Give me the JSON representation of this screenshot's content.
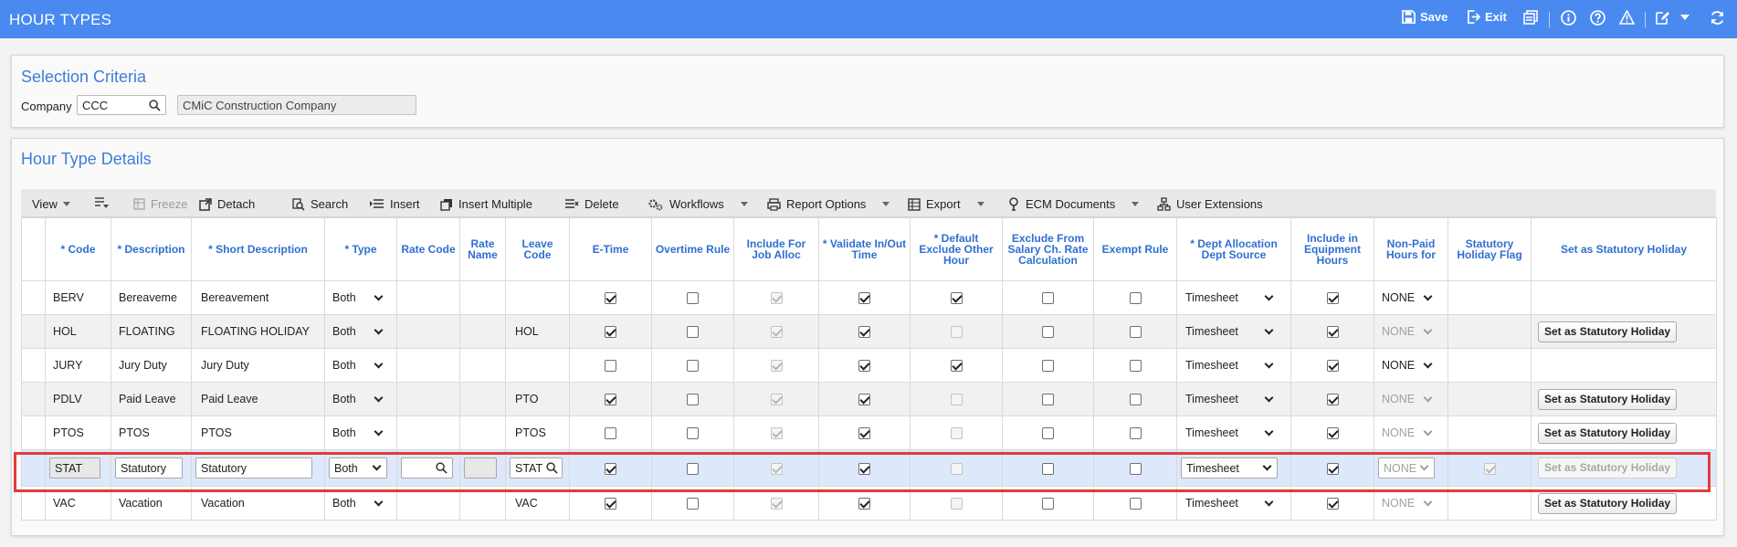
{
  "header": {
    "title": "HOUR TYPES",
    "save_label": "Save",
    "exit_label": "Exit"
  },
  "selection": {
    "title": "Selection Criteria",
    "company_label": "Company",
    "company_code": "CCC",
    "company_name": "CMiC Construction Company"
  },
  "details": {
    "title": "Hour Type Details",
    "toolbar": {
      "view": "View",
      "freeze": "Freeze",
      "detach": "Detach",
      "search": "Search",
      "insert": "Insert",
      "insert_multiple": "Insert Multiple",
      "delete": "Delete",
      "workflows": "Workflows",
      "report_options": "Report Options",
      "export": "Export",
      "ecm_documents": "ECM Documents",
      "user_extensions": "User Extensions"
    },
    "columns": {
      "code": "* Code",
      "description": "* Description",
      "short_description": "* Short Description",
      "type": "* Type",
      "rate_code": "Rate Code",
      "rate_name": "Rate Name",
      "leave_code": "Leave Code",
      "etime": "E-Time",
      "overtime_rule": "Overtime Rule",
      "include_job_alloc": "Include For Job Alloc",
      "validate_inout": "* Validate In/Out Time",
      "default_exclude": "* Default Exclude Other Hour",
      "exclude_salary": "Exclude From Salary Ch. Rate Calculation",
      "exempt_rule": "Exempt Rule",
      "dept_alloc": "* Dept Allocation Dept Source",
      "include_equip": "Include in Equipment Hours",
      "non_paid": "Non-Paid Hours for",
      "stat_flag": "Statutory Holiday Flag",
      "set_stat": "Set as Statutory Holiday"
    },
    "rows": [
      {
        "code": "BERV",
        "description": "Bereaveme",
        "short": "Bereavement",
        "type": "Both",
        "rate_code": "",
        "rate_name": "",
        "leave_code": "",
        "etime": true,
        "overtime": false,
        "job_alloc": true,
        "validate": true,
        "default_exclude": true,
        "default_exclude_dis": false,
        "exclude_salary": false,
        "exempt": false,
        "dept": "Timesheet",
        "equip": true,
        "non_paid": "NONE",
        "non_paid_dis": false,
        "stat_btn": ""
      },
      {
        "code": "HOL",
        "description": "FLOATING",
        "short": "FLOATING HOLIDAY",
        "type": "Both",
        "rate_code": "",
        "rate_name": "",
        "leave_code": "HOL",
        "etime": true,
        "overtime": false,
        "job_alloc": true,
        "validate": true,
        "default_exclude": false,
        "default_exclude_dis": true,
        "exclude_salary": false,
        "exempt": false,
        "dept": "Timesheet",
        "equip": true,
        "non_paid": "NONE",
        "non_paid_dis": true,
        "stat_btn": "Set as Statutory Holiday"
      },
      {
        "code": "JURY",
        "description": "Jury Duty",
        "short": "Jury Duty",
        "type": "Both",
        "rate_code": "",
        "rate_name": "",
        "leave_code": "",
        "etime": false,
        "overtime": false,
        "job_alloc": true,
        "validate": true,
        "default_exclude": true,
        "default_exclude_dis": false,
        "exclude_salary": false,
        "exempt": false,
        "dept": "Timesheet",
        "equip": true,
        "non_paid": "NONE",
        "non_paid_dis": false,
        "stat_btn": ""
      },
      {
        "code": "PDLV",
        "description": "Paid Leave",
        "short": "Paid Leave",
        "type": "Both",
        "rate_code": "",
        "rate_name": "",
        "leave_code": "PTO",
        "etime": true,
        "overtime": false,
        "job_alloc": true,
        "validate": true,
        "default_exclude": false,
        "default_exclude_dis": true,
        "exclude_salary": false,
        "exempt": false,
        "dept": "Timesheet",
        "equip": true,
        "non_paid": "NONE",
        "non_paid_dis": true,
        "stat_btn": "Set as Statutory Holiday"
      },
      {
        "code": "PTOS",
        "description": "PTOS",
        "short": "PTOS",
        "type": "Both",
        "rate_code": "",
        "rate_name": "",
        "leave_code": "PTOS",
        "etime": false,
        "overtime": false,
        "job_alloc": true,
        "validate": true,
        "default_exclude": false,
        "default_exclude_dis": true,
        "exclude_salary": false,
        "exempt": false,
        "dept": "Timesheet",
        "equip": true,
        "non_paid": "NONE",
        "non_paid_dis": true,
        "stat_btn": "Set as Statutory Holiday"
      },
      {
        "code": "STAT",
        "description": "Statutory",
        "short": "Statutory",
        "type": "Both",
        "rate_code": "",
        "rate_name": "",
        "leave_code": "STAT",
        "etime": true,
        "overtime": false,
        "job_alloc": true,
        "validate": true,
        "default_exclude": false,
        "default_exclude_dis": true,
        "exclude_salary": false,
        "exempt": false,
        "dept": "Timesheet",
        "equip": true,
        "non_paid": "NONE",
        "non_paid_dis": true,
        "stat_btn": "Set as Statutory Holiday"
      },
      {
        "code": "VAC",
        "description": "Vacation",
        "short": "Vacation",
        "type": "Both",
        "rate_code": "",
        "rate_name": "",
        "leave_code": "VAC",
        "etime": true,
        "overtime": false,
        "job_alloc": true,
        "validate": true,
        "default_exclude": false,
        "default_exclude_dis": true,
        "exclude_salary": false,
        "exempt": false,
        "dept": "Timesheet",
        "equip": true,
        "non_paid": "NONE",
        "non_paid_dis": true,
        "stat_btn": "Set as Statutory Holiday"
      }
    ]
  },
  "colors": {
    "header_bg": "#4a8af0",
    "title_blue": "#3d7ed8",
    "selected_row": "#dde8fb",
    "highlight_red": "#e23b3b"
  },
  "icons": [
    "save-icon",
    "exit-icon",
    "report-icon",
    "info-icon",
    "help-icon",
    "warning-icon",
    "edit-icon",
    "refresh-icon",
    "search-icon"
  ]
}
